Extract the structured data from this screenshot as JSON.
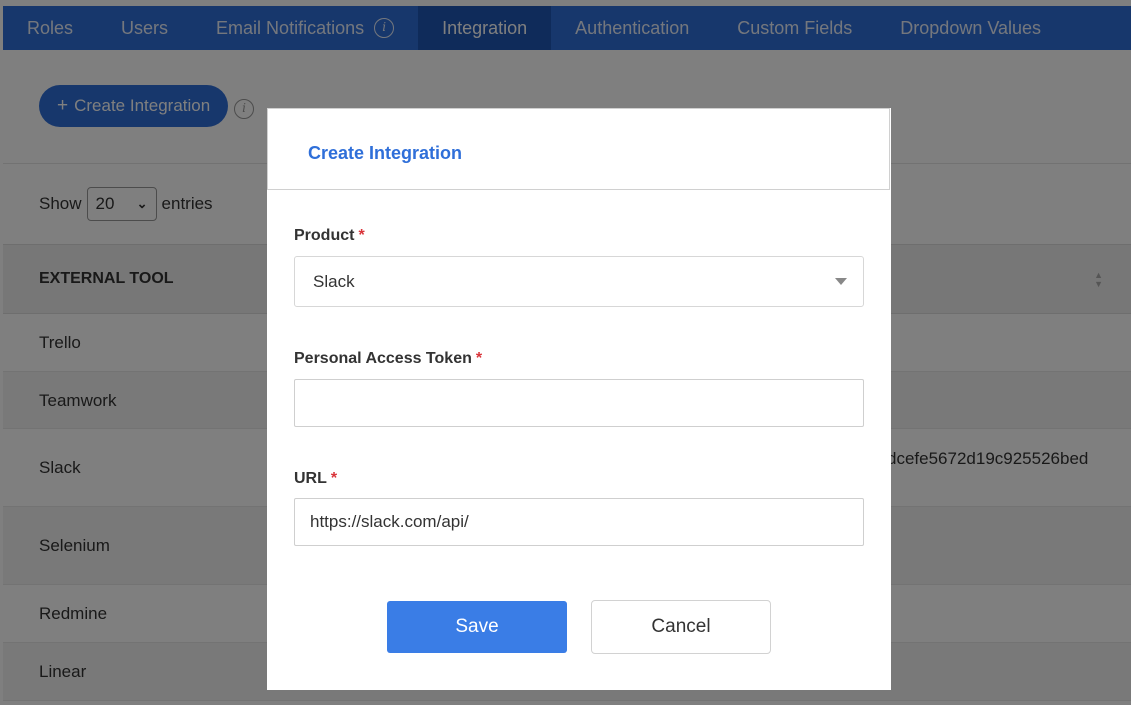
{
  "nav": {
    "tabs": [
      {
        "label": "Roles"
      },
      {
        "label": "Users"
      },
      {
        "label": "Email Notifications"
      },
      {
        "label": "Integration"
      },
      {
        "label": "Authentication"
      },
      {
        "label": "Custom Fields"
      },
      {
        "label": "Dropdown Values"
      }
    ],
    "active_tab": "Integration",
    "info_icon": "i"
  },
  "page": {
    "create_button_icon": "+",
    "create_button_label": "Create Integration",
    "info_icon": "i",
    "show_label": "Show",
    "entries_value": "20",
    "entries_label": "entries"
  },
  "table": {
    "header": "EXTERNAL TOOL",
    "rows": [
      {
        "tool": "Trello"
      },
      {
        "tool": "Teamwork"
      },
      {
        "tool": "Slack",
        "token": "dcefe5672d19c925526bed"
      },
      {
        "tool": "Selenium"
      },
      {
        "tool": "Redmine"
      },
      {
        "tool": "Linear"
      }
    ]
  },
  "modal": {
    "title": "Create Integration",
    "product_label": "Product",
    "product_value": "Slack",
    "token_label": "Personal Access Token",
    "token_value": "",
    "url_label": "URL",
    "url_value": "https://slack.com/api/",
    "required_mark": "*",
    "save_label": "Save",
    "cancel_label": "Cancel"
  },
  "colors": {
    "nav_bg": "#2f6fd9",
    "nav_active": "#1f56b5",
    "primary": "#3a7de6",
    "required": "#d9343a"
  }
}
